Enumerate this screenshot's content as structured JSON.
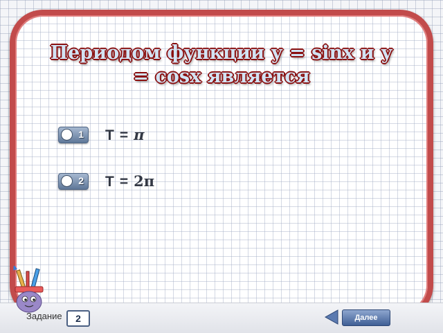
{
  "question": {
    "title": "Периодом функции у = sinx  и у = cosx является"
  },
  "options": [
    {
      "number": "1",
      "variable": "T",
      "equals": "=",
      "value": "π"
    },
    {
      "number": "2",
      "variable": "T",
      "equals": "=",
      "value": "2π"
    }
  ],
  "footer": {
    "task_label": "Задание",
    "task_number": "2",
    "next_label": "Далее"
  },
  "icons": {
    "back": "triangle-left-icon",
    "mascot": "pencil-mascot-icon"
  },
  "colors": {
    "frame": "#c24b4b",
    "title_text": "#d2e3f3",
    "title_outline": "#8a1010",
    "button": "#3f5f95"
  }
}
